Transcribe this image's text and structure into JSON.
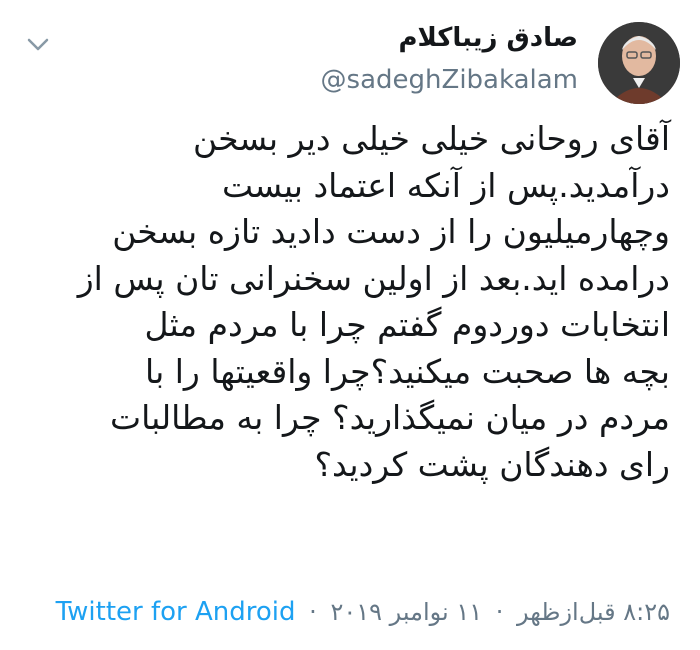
{
  "author": {
    "display_name": "صادق زیباکلام",
    "handle": "@sadeghZibakalam"
  },
  "tweet": {
    "lines": [
      "آقای روحانی خیلی خیلی دیر بسخن",
      "درآمدید.پس از آنکه اعتماد بیست",
      "وچهارمیلیون را از دست دادید تازه بسخن",
      "درامده اید.بعد از اولین سخنرانی تان پس از",
      "انتخابات دوردوم گفتم چرا با مردم مثل",
      "بچه ها صحبت میکنید؟چرا واقعیتها را با",
      "مردم در میان نمیگذارید؟ چرا به مطالبات",
      "رای دهندگان پشت کردید؟"
    ]
  },
  "meta": {
    "time": "۸:۲۵ قبل‌ازظهر",
    "separator": "·",
    "date": "۱۱ نوامبر ۲۰۱۹",
    "source": "Twitter for Android"
  },
  "icons": {
    "menu": "chevron-down-icon",
    "avatar": "avatar"
  },
  "colors": {
    "text": "#14171a",
    "secondary": "#657786",
    "link": "#1da1f2"
  }
}
